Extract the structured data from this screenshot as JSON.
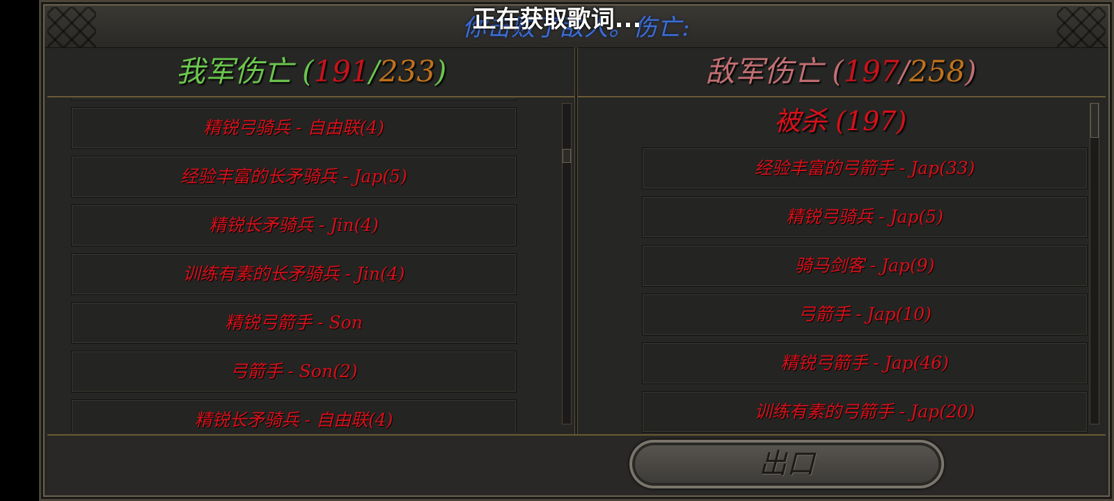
{
  "overlay_text": "正在获取歌词...",
  "battle_result": "你击败了敌人。伤亡:",
  "our_casualties": {
    "title": "我军伤亡",
    "lost": "191",
    "total": "233"
  },
  "enemy_casualties": {
    "title": "敌军伤亡",
    "lost": "197",
    "total": "258"
  },
  "our_list": [
    "精锐弓骑兵 - 自由联(4)",
    "经验丰富的长矛骑兵 - Jap(5)",
    "精锐长矛骑兵 - Jin(4)",
    "训练有素的长矛骑兵 - Jin(4)",
    "精锐弓箭手 - Son",
    "弓箭手 - Son(2)",
    "精锐长矛骑兵 - 自由联(4)"
  ],
  "enemy_section": {
    "label": "被杀",
    "count": "197"
  },
  "enemy_list": [
    "经验丰富的弓箭手 - Jap(33)",
    "精锐弓骑兵 - Jap(5)",
    "骑马剑客 - Jap(9)",
    "弓箭手 - Jap(10)",
    "精锐弓箭手 - Jap(46)",
    "训练有素的弓箭手 - Jap(20)"
  ],
  "exit_button": "出口",
  "colors": {
    "ally_title": "#6bc64e",
    "enemy_title": "#c26f73",
    "unit_text": "#d8101a",
    "result_text": "#3e6fd6"
  }
}
